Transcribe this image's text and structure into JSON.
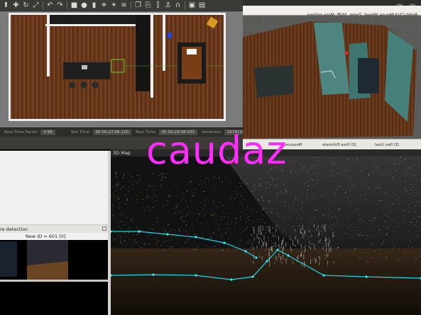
{
  "gazebo": {
    "toolbar_icons": [
      "select-icon",
      "translate-icon",
      "rotate-icon",
      "scale-icon",
      "undo-icon",
      "redo-icon",
      "box-icon",
      "sphere-icon",
      "cylinder-icon",
      "point-light-icon",
      "spot-light-icon",
      "directional-light-icon",
      "copy-icon",
      "paste-icon",
      "align-icon",
      "snap-icon",
      "magnet-icon",
      "screenshot-icon",
      "record-icon"
    ],
    "status": {
      "real_time_factor_label": "Real Time Factor:",
      "real_time_factor": "0.96",
      "sim_time_label": "Sim Time:",
      "sim_time": "00 00:27:56.120",
      "real_time_label": "Real Time:",
      "real_time": "00 00:29:08.033",
      "iterations_label": "Iterations:",
      "iterations": "1678120"
    }
  },
  "rviz": {
    "hint": "Right-Click/Mouse Wheel: Zoom. Shift: More options.",
    "tools": [
      "2D Nav Goal",
      "2D Pose Estimate",
      "Measure"
    ]
  },
  "detection": {
    "title": "re detection",
    "new_id": "New ID = 601 [0]"
  },
  "map": {
    "title": "3D Map"
  },
  "watermark": "caudaz",
  "colors": {
    "accent": "#ff2bff",
    "trajectory": "#19d6e6",
    "floor_wood": "#6b3a1d"
  }
}
